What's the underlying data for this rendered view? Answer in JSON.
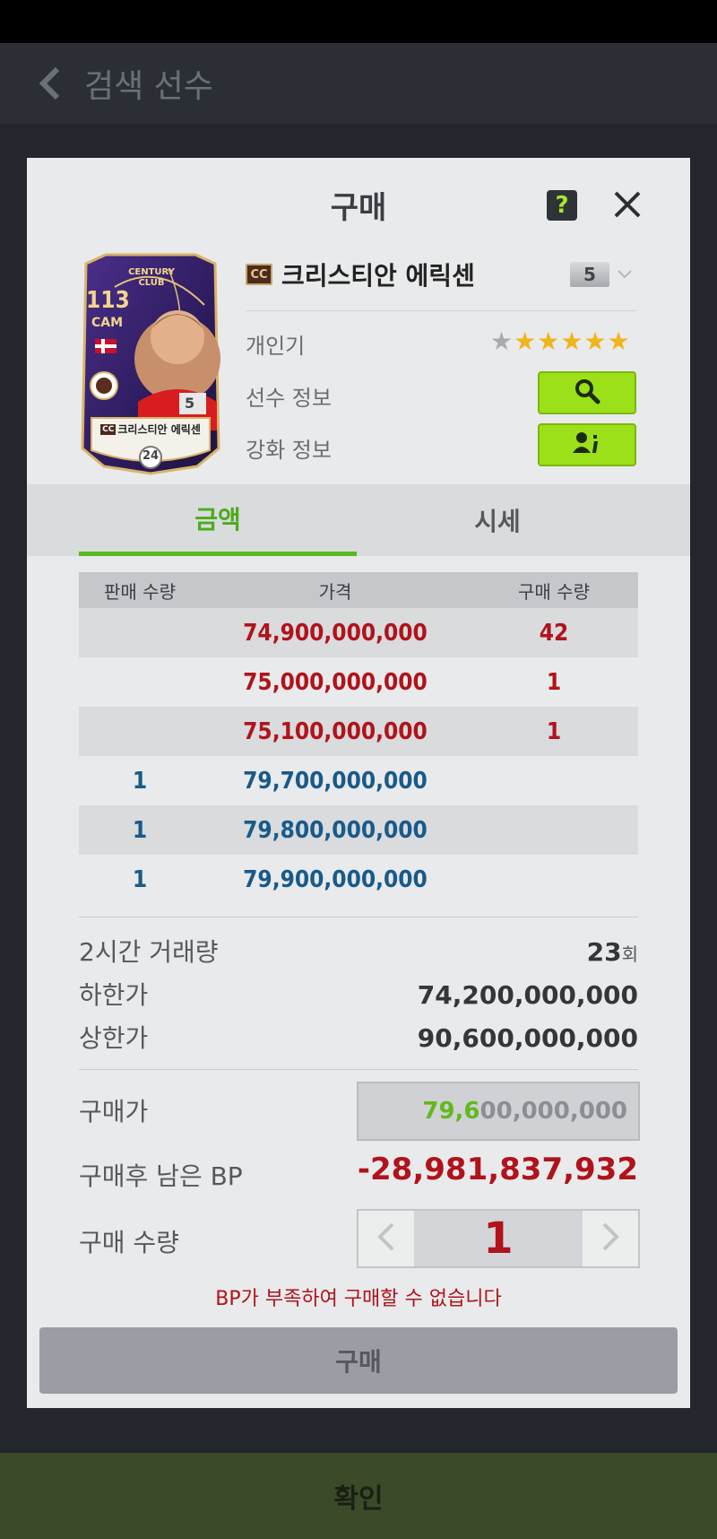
{
  "background": {
    "header_title": "검색 선수",
    "confirm_label": "확인"
  },
  "modal": {
    "title": "구매",
    "help_label": "?",
    "card": {
      "ovr": "113",
      "position": "CAM",
      "season_line1": "CENTURY",
      "season_line2": "CLUB",
      "enhance": "5",
      "name": "크리스티안 에릭센",
      "name_badge": "CC",
      "bottom_number": "24"
    },
    "player": {
      "season_badge": "CC",
      "name": "크리스티안 에릭센",
      "grade": "5"
    },
    "info": {
      "popularity_label": "개인기",
      "popularity_stars": 5,
      "popularity_max": 6,
      "player_info_label": "선수 정보",
      "enhance_info_label": "강화 정보"
    },
    "tabs": [
      {
        "label": "금액",
        "active": true
      },
      {
        "label": "시세",
        "active": false
      }
    ],
    "table": {
      "headers": [
        "판매 수량",
        "가격",
        "구매 수량"
      ],
      "rows": [
        {
          "sell_qty": "",
          "price": "74,900,000,000",
          "buy_qty": "42",
          "type": "buy"
        },
        {
          "sell_qty": "",
          "price": "75,000,000,000",
          "buy_qty": "1",
          "type": "buy"
        },
        {
          "sell_qty": "",
          "price": "75,100,000,000",
          "buy_qty": "1",
          "type": "buy"
        },
        {
          "sell_qty": "1",
          "price": "79,700,000,000",
          "buy_qty": "",
          "type": "sell"
        },
        {
          "sell_qty": "1",
          "price": "79,800,000,000",
          "buy_qty": "",
          "type": "sell"
        },
        {
          "sell_qty": "1",
          "price": "79,900,000,000",
          "buy_qty": "",
          "type": "sell"
        }
      ]
    },
    "stats": {
      "volume_label": "2시간 거래량",
      "volume_value": "23",
      "volume_unit": "회",
      "lower_label": "하한가",
      "lower_value": "74,200,000,000",
      "upper_label": "상한가",
      "upper_value": "90,600,000,000"
    },
    "purchase": {
      "price_label": "구매가",
      "price_highlight": "79,6",
      "price_rest": "00,000,000",
      "remaining_label": "구매후 남은 BP",
      "remaining_value": "-28,981,837,932",
      "qty_label": "구매 수량",
      "qty_value": "1",
      "warning": "BP가 부족하여 구매할 수 없습니다",
      "buy_label": "구매"
    }
  },
  "colors": {
    "accent_green": "#9be018",
    "price_red": "#b0131b",
    "price_blue": "#185a8a"
  }
}
